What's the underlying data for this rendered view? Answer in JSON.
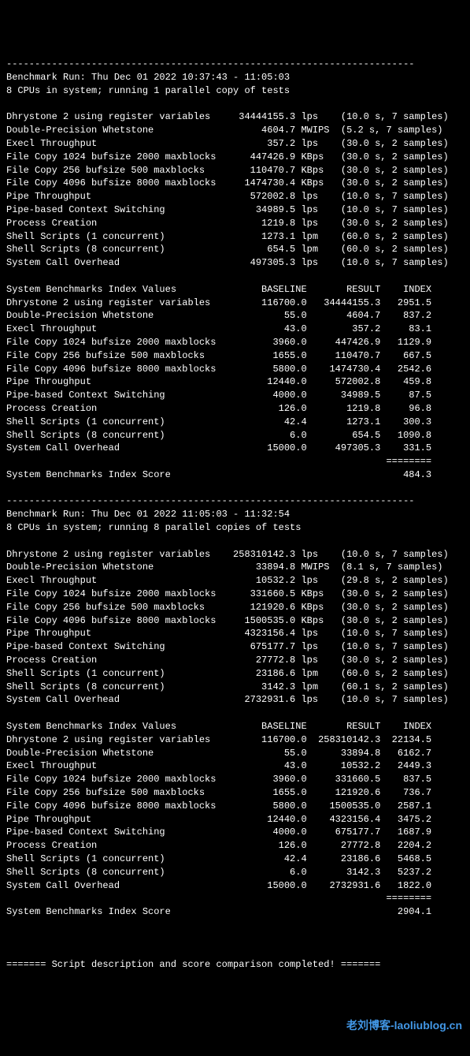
{
  "divider": "------------------------------------------------------------------------",
  "run1": {
    "header1": "Benchmark Run: Thu Dec 01 2022 10:37:43 - 11:05:03",
    "header2": "8 CPUs in system; running 1 parallel copy of tests",
    "raw": [
      {
        "name": "Dhrystone 2 using register variables",
        "val": "34444155.3",
        "unit": "lps",
        "det": "(10.0 s, 7 samples)"
      },
      {
        "name": "Double-Precision Whetstone",
        "val": "4604.7",
        "unit": "MWIPS",
        "det": "(5.2 s, 7 samples)"
      },
      {
        "name": "Execl Throughput",
        "val": "357.2",
        "unit": "lps",
        "det": "(30.0 s, 2 samples)"
      },
      {
        "name": "File Copy 1024 bufsize 2000 maxblocks",
        "val": "447426.9",
        "unit": "KBps",
        "det": "(30.0 s, 2 samples)"
      },
      {
        "name": "File Copy 256 bufsize 500 maxblocks",
        "val": "110470.7",
        "unit": "KBps",
        "det": "(30.0 s, 2 samples)"
      },
      {
        "name": "File Copy 4096 bufsize 8000 maxblocks",
        "val": "1474730.4",
        "unit": "KBps",
        "det": "(30.0 s, 2 samples)"
      },
      {
        "name": "Pipe Throughput",
        "val": "572002.8",
        "unit": "lps",
        "det": "(10.0 s, 7 samples)"
      },
      {
        "name": "Pipe-based Context Switching",
        "val": "34989.5",
        "unit": "lps",
        "det": "(10.0 s, 7 samples)"
      },
      {
        "name": "Process Creation",
        "val": "1219.8",
        "unit": "lps",
        "det": "(30.0 s, 2 samples)"
      },
      {
        "name": "Shell Scripts (1 concurrent)",
        "val": "1273.1",
        "unit": "lpm",
        "det": "(60.0 s, 2 samples)"
      },
      {
        "name": "Shell Scripts (8 concurrent)",
        "val": "654.5",
        "unit": "lpm",
        "det": "(60.0 s, 2 samples)"
      },
      {
        "name": "System Call Overhead",
        "val": "497305.3",
        "unit": "lps",
        "det": "(10.0 s, 7 samples)"
      }
    ],
    "index_header": "System Benchmarks Index Values               BASELINE       RESULT    INDEX",
    "index": [
      {
        "name": "Dhrystone 2 using register variables",
        "base": "116700.0",
        "res": "34444155.3",
        "idx": "2951.5"
      },
      {
        "name": "Double-Precision Whetstone",
        "base": "55.0",
        "res": "4604.7",
        "idx": "837.2"
      },
      {
        "name": "Execl Throughput",
        "base": "43.0",
        "res": "357.2",
        "idx": "83.1"
      },
      {
        "name": "File Copy 1024 bufsize 2000 maxblocks",
        "base": "3960.0",
        "res": "447426.9",
        "idx": "1129.9"
      },
      {
        "name": "File Copy 256 bufsize 500 maxblocks",
        "base": "1655.0",
        "res": "110470.7",
        "idx": "667.5"
      },
      {
        "name": "File Copy 4096 bufsize 8000 maxblocks",
        "base": "5800.0",
        "res": "1474730.4",
        "idx": "2542.6"
      },
      {
        "name": "Pipe Throughput",
        "base": "12440.0",
        "res": "572002.8",
        "idx": "459.8"
      },
      {
        "name": "Pipe-based Context Switching",
        "base": "4000.0",
        "res": "34989.5",
        "idx": "87.5"
      },
      {
        "name": "Process Creation",
        "base": "126.0",
        "res": "1219.8",
        "idx": "96.8"
      },
      {
        "name": "Shell Scripts (1 concurrent)",
        "base": "42.4",
        "res": "1273.1",
        "idx": "300.3"
      },
      {
        "name": "Shell Scripts (8 concurrent)",
        "base": "6.0",
        "res": "654.5",
        "idx": "1090.8"
      },
      {
        "name": "System Call Overhead",
        "base": "15000.0",
        "res": "497305.3",
        "idx": "331.5"
      }
    ],
    "score_label": "System Benchmarks Index Score",
    "score": "484.3"
  },
  "run2": {
    "header1": "Benchmark Run: Thu Dec 01 2022 11:05:03 - 11:32:54",
    "header2": "8 CPUs in system; running 8 parallel copies of tests",
    "raw": [
      {
        "name": "Dhrystone 2 using register variables",
        "val": "258310142.3",
        "unit": "lps",
        "det": "(10.0 s, 7 samples)"
      },
      {
        "name": "Double-Precision Whetstone",
        "val": "33894.8",
        "unit": "MWIPS",
        "det": "(8.1 s, 7 samples)"
      },
      {
        "name": "Execl Throughput",
        "val": "10532.2",
        "unit": "lps",
        "det": "(29.8 s, 2 samples)"
      },
      {
        "name": "File Copy 1024 bufsize 2000 maxblocks",
        "val": "331660.5",
        "unit": "KBps",
        "det": "(30.0 s, 2 samples)"
      },
      {
        "name": "File Copy 256 bufsize 500 maxblocks",
        "val": "121920.6",
        "unit": "KBps",
        "det": "(30.0 s, 2 samples)"
      },
      {
        "name": "File Copy 4096 bufsize 8000 maxblocks",
        "val": "1500535.0",
        "unit": "KBps",
        "det": "(30.0 s, 2 samples)"
      },
      {
        "name": "Pipe Throughput",
        "val": "4323156.4",
        "unit": "lps",
        "det": "(10.0 s, 7 samples)"
      },
      {
        "name": "Pipe-based Context Switching",
        "val": "675177.7",
        "unit": "lps",
        "det": "(10.0 s, 7 samples)"
      },
      {
        "name": "Process Creation",
        "val": "27772.8",
        "unit": "lps",
        "det": "(30.0 s, 2 samples)"
      },
      {
        "name": "Shell Scripts (1 concurrent)",
        "val": "23186.6",
        "unit": "lpm",
        "det": "(60.0 s, 2 samples)"
      },
      {
        "name": "Shell Scripts (8 concurrent)",
        "val": "3142.3",
        "unit": "lpm",
        "det": "(60.1 s, 2 samples)"
      },
      {
        "name": "System Call Overhead",
        "val": "2732931.6",
        "unit": "lps",
        "det": "(10.0 s, 7 samples)"
      }
    ],
    "index_header": "System Benchmarks Index Values               BASELINE       RESULT    INDEX",
    "index": [
      {
        "name": "Dhrystone 2 using register variables",
        "base": "116700.0",
        "res": "258310142.3",
        "idx": "22134.5"
      },
      {
        "name": "Double-Precision Whetstone",
        "base": "55.0",
        "res": "33894.8",
        "idx": "6162.7"
      },
      {
        "name": "Execl Throughput",
        "base": "43.0",
        "res": "10532.2",
        "idx": "2449.3"
      },
      {
        "name": "File Copy 1024 bufsize 2000 maxblocks",
        "base": "3960.0",
        "res": "331660.5",
        "idx": "837.5"
      },
      {
        "name": "File Copy 256 bufsize 500 maxblocks",
        "base": "1655.0",
        "res": "121920.6",
        "idx": "736.7"
      },
      {
        "name": "File Copy 4096 bufsize 8000 maxblocks",
        "base": "5800.0",
        "res": "1500535.0",
        "idx": "2587.1"
      },
      {
        "name": "Pipe Throughput",
        "base": "12440.0",
        "res": "4323156.4",
        "idx": "3475.2"
      },
      {
        "name": "Pipe-based Context Switching",
        "base": "4000.0",
        "res": "675177.7",
        "idx": "1687.9"
      },
      {
        "name": "Process Creation",
        "base": "126.0",
        "res": "27772.8",
        "idx": "2204.2"
      },
      {
        "name": "Shell Scripts (1 concurrent)",
        "base": "42.4",
        "res": "23186.6",
        "idx": "5468.5"
      },
      {
        "name": "Shell Scripts (8 concurrent)",
        "base": "6.0",
        "res": "3142.3",
        "idx": "5237.2"
      },
      {
        "name": "System Call Overhead",
        "base": "15000.0",
        "res": "2732931.6",
        "idx": "1822.0"
      }
    ],
    "score_label": "System Benchmarks Index Score",
    "score": "2904.1"
  },
  "footer": "======= Script description and score comparison completed! =======",
  "watermark": "老刘博客-laoliublog.cn"
}
